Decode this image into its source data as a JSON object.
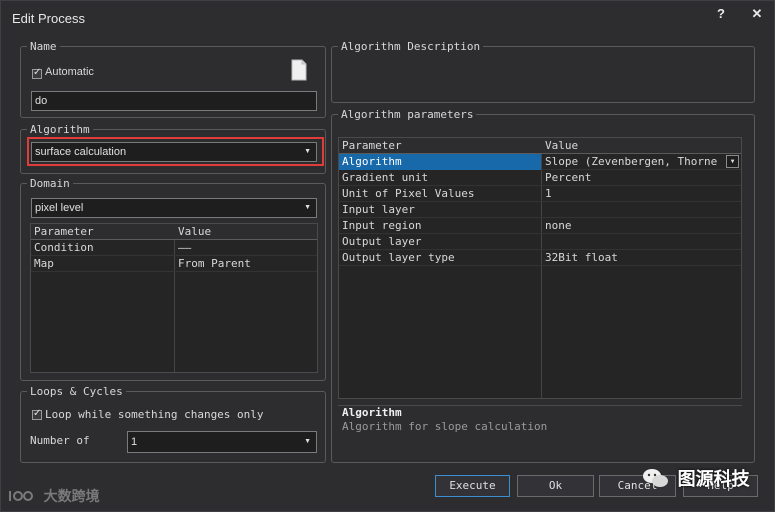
{
  "window": {
    "title": "Edit Process",
    "help_label": "?",
    "close_label": "✕"
  },
  "name_group": {
    "legend": "Name",
    "automatic_label": "Automatic",
    "name_value": "do"
  },
  "algorithm_group": {
    "legend": "Algorithm",
    "selected": "surface calculation"
  },
  "domain_group": {
    "legend": "Domain",
    "selected": "pixel level",
    "grid": {
      "headers": [
        "Parameter",
        "Value"
      ],
      "rows": [
        {
          "param": "Condition",
          "value": "——"
        },
        {
          "param": "Map",
          "value": "From Parent"
        }
      ]
    }
  },
  "loops_group": {
    "legend": "Loops & Cycles",
    "loop_label": "Loop while something changes only",
    "number_label": "Number of",
    "number_value": "1"
  },
  "description_group": {
    "legend": "Algorithm Description"
  },
  "params_group": {
    "legend": "Algorithm parameters",
    "headers": [
      "Parameter",
      "Value"
    ],
    "rows": [
      {
        "param": "Algorithm",
        "value": "Slope (Zevenbergen, Thorne (ER"
      },
      {
        "param": "Gradient unit",
        "value": "Percent"
      },
      {
        "param": "Unit of Pixel Values",
        "value": "1"
      },
      {
        "param": "Input layer",
        "value": ""
      },
      {
        "param": "Input region",
        "value": "none"
      },
      {
        "param": "Output layer",
        "value": ""
      },
      {
        "param": "Output layer type",
        "value": "32Bit float"
      }
    ],
    "info_title": "Algorithm",
    "info_text": "Algorithm for slope calculation"
  },
  "buttons": {
    "execute": "Execute",
    "ok": "Ok",
    "cancel": "Cancel",
    "help": "Help"
  },
  "watermarks": {
    "left": "大数跨境",
    "right": "图源科技"
  },
  "colors": {
    "highlight_border": "#e03c3c",
    "selection": "#1769aa",
    "accent": "#3c8fd0"
  }
}
